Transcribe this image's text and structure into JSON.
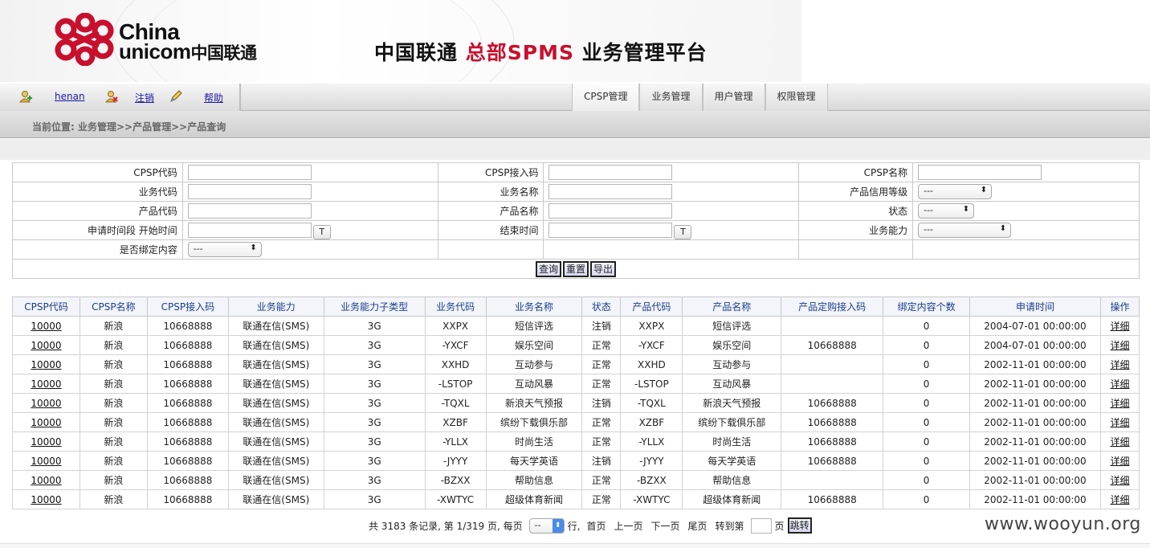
{
  "header": {
    "logo_line1": "China",
    "logo_line2": "unicom",
    "logo_line2_cn": "中国联通",
    "title_prefix": "中国联通",
    "title_red": "总部SPMS",
    "title_suffix": "业务管理平台",
    "brand_red": "#c8102e"
  },
  "nav": {
    "user_link": "henan",
    "logout_link": "注销",
    "help_link": "帮助",
    "tabs": [
      "CPSP管理",
      "业务管理",
      "用户管理",
      "权限管理"
    ]
  },
  "breadcrumb": "当前位置:  业务管理>>产品管理>>产品查询",
  "form": {
    "cpsp_code": "CPSP代码",
    "cpsp_access": "CPSP接入码",
    "cpsp_name": "CPSP名称",
    "service_code": "业务代码",
    "service_name": "业务名称",
    "credit_level": "产品信用等级",
    "product_code": "产品代码",
    "product_name": "产品名称",
    "status": "状态",
    "apply_start": "申请时间段 开始时间",
    "end_time": "结束时间",
    "capability": "业务能力",
    "bind_content": "是否绑定内容",
    "select_default": "---",
    "t_btn": "T",
    "query_btn": "查询",
    "reset_btn": "重置",
    "export_btn": "导出"
  },
  "table": {
    "headers": [
      "CPSP代码",
      "CPSP名称",
      "CPSP接入码",
      "业务能力",
      "业务能力子类型",
      "业务代码",
      "业务名称",
      "状态",
      "产品代码",
      "产品名称",
      "产品定购接入码",
      "绑定内容个数",
      "申请时间",
      "操作"
    ],
    "rows": [
      [
        "10000",
        "新浪",
        "10668888",
        "联通在信(SMS)",
        "3G",
        "XXPX",
        "短信评选",
        "注销",
        "XXPX",
        "短信评选",
        "",
        "0",
        "2004-07-01 00:00:00",
        "详细"
      ],
      [
        "10000",
        "新浪",
        "10668888",
        "联通在信(SMS)",
        "3G",
        "-YXCF",
        "娱乐空间",
        "正常",
        "-YXCF",
        "娱乐空间",
        "10668888",
        "0",
        "2004-07-01 00:00:00",
        "详细"
      ],
      [
        "10000",
        "新浪",
        "10668888",
        "联通在信(SMS)",
        "3G",
        "XXHD",
        "互动参与",
        "正常",
        "XXHD",
        "互动参与",
        "",
        "0",
        "2002-11-01 00:00:00",
        "详细"
      ],
      [
        "10000",
        "新浪",
        "10668888",
        "联通在信(SMS)",
        "3G",
        "-LSTOP",
        "互动风暴",
        "正常",
        "-LSTOP",
        "互动风暴",
        "",
        "0",
        "2002-11-01 00:00:00",
        "详细"
      ],
      [
        "10000",
        "新浪",
        "10668888",
        "联通在信(SMS)",
        "3G",
        "-TQXL",
        "新浪天气预报",
        "注销",
        "-TQXL",
        "新浪天气预报",
        "10668888",
        "0",
        "2002-11-01 00:00:00",
        "详细"
      ],
      [
        "10000",
        "新浪",
        "10668888",
        "联通在信(SMS)",
        "3G",
        "XZBF",
        "缤纷下载俱乐部",
        "正常",
        "XZBF",
        "缤纷下载俱乐部",
        "10668888",
        "0",
        "2002-11-01 00:00:00",
        "详细"
      ],
      [
        "10000",
        "新浪",
        "10668888",
        "联通在信(SMS)",
        "3G",
        "-YLLX",
        "时尚生活",
        "正常",
        "-YLLX",
        "时尚生活",
        "10668888",
        "0",
        "2002-11-01 00:00:00",
        "详细"
      ],
      [
        "10000",
        "新浪",
        "10668888",
        "联通在信(SMS)",
        "3G",
        "-JYYY",
        "每天学英语",
        "注销",
        "-JYYY",
        "每天学英语",
        "10668888",
        "0",
        "2002-11-01 00:00:00",
        "详细"
      ],
      [
        "10000",
        "新浪",
        "10668888",
        "联通在信(SMS)",
        "3G",
        "-BZXX",
        "帮助信息",
        "正常",
        "-BZXX",
        "帮助信息",
        "",
        "0",
        "2002-11-01 00:00:00",
        "详细"
      ],
      [
        "10000",
        "新浪",
        "10668888",
        "联通在信(SMS)",
        "3G",
        "-XWTYC",
        "超级体育新闻",
        "正常",
        "-XWTYC",
        "超级体育新闻",
        "10668888",
        "0",
        "2002-11-01 00:00:00",
        "详细"
      ]
    ]
  },
  "pager": {
    "summary": "共 3183 条记录, 第 1/319 页, 每页",
    "per_page_value": "--",
    "row_label": "行,",
    "first": "首页",
    "prev": "上一页",
    "next": "下一页",
    "last": "尾页",
    "goto": "转到第",
    "page_unit": "页",
    "jump_btn": "跳转"
  },
  "watermark": "www.wooyun.org"
}
